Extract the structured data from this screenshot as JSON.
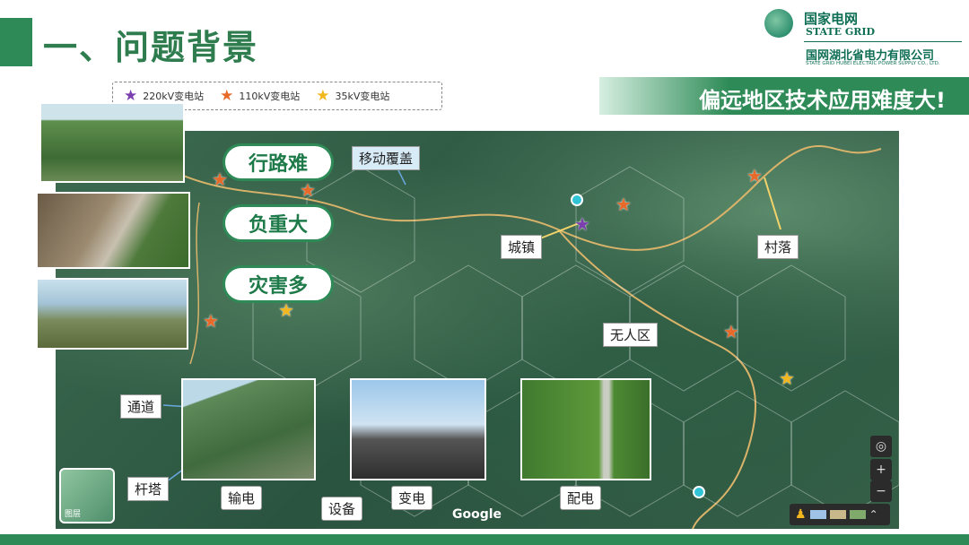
{
  "header": {
    "title": "一、问题背景",
    "brand_cn": "国家电网",
    "brand_en": "STATE GRID",
    "brand_sub_cn": "国网湖北省电力有限公司",
    "brand_sub_en": "STATE GRID HUBEI ELECTRIC POWER SUPPLY CO., LTD."
  },
  "legend": {
    "items": [
      {
        "label": "220kV变电站",
        "color": "#7b3fb0"
      },
      {
        "label": "110kV变电站",
        "color": "#e86a2a"
      },
      {
        "label": "35kV变电站",
        "color": "#f2b61f"
      }
    ]
  },
  "banner": {
    "text": "偏远地区技术应用难度大!"
  },
  "challenges": [
    "行路难",
    "负重大",
    "灾害多"
  ],
  "map_labels": {
    "mobile": "移动覆盖",
    "town": "城镇",
    "village": "村落",
    "noman": "无人区",
    "channel": "通道",
    "tower": "杆塔",
    "transmission": "输电",
    "equipment": "设备",
    "substation": "变电",
    "distribution": "配电",
    "google": "Google",
    "layers": "图层"
  },
  "colors": {
    "primary": "#2e8b57",
    "dark": "#0f6f55"
  }
}
